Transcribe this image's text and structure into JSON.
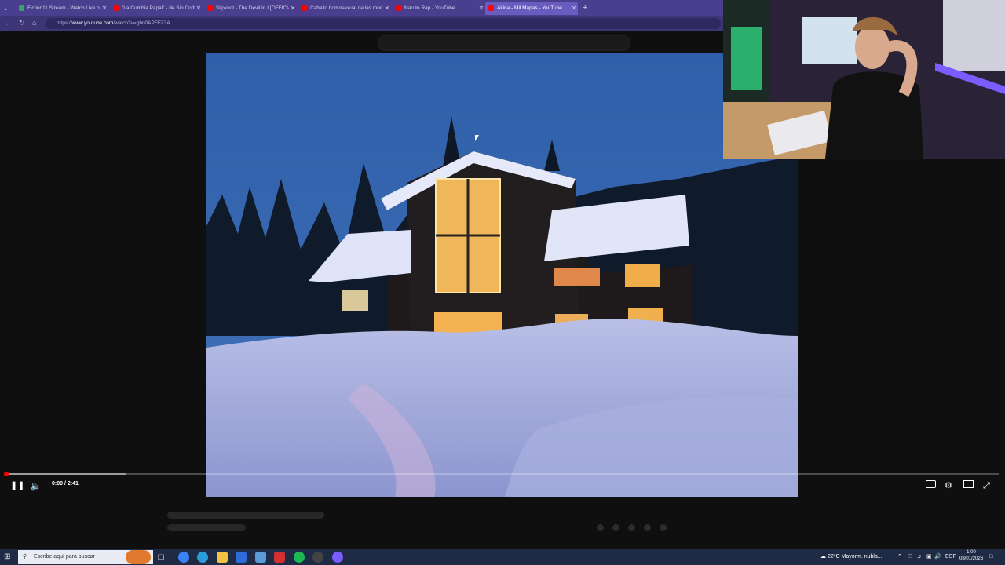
{
  "browser": {
    "tabs": [
      {
        "title": "Fiction11 Stream - Watch Live on",
        "active": false,
        "icon_color": "#3aa36b"
      },
      {
        "title": "\"La Cumbia Papal\" - de Sin Codific",
        "active": false,
        "icon_color": "#ff0000"
      },
      {
        "title": "Slipknot - The Devil In I [OFFICIAL",
        "active": false,
        "icon_color": "#ff0000"
      },
      {
        "title": "Caballo homosexual de las monta",
        "active": false,
        "icon_color": "#ff0000"
      },
      {
        "title": "Naruto Rap - YouTube",
        "active": false,
        "icon_color": "#ff0000"
      },
      {
        "title": "Akina - Mil Mapas - YouTube",
        "active": true,
        "icon_color": "#ff0000"
      }
    ],
    "url_prefix": "https://",
    "url_host": "www.youtube.com",
    "url_path": "/watch?v=gbn0APFFZ3A"
  },
  "player": {
    "time": "0:00 / 2:41",
    "progress_fraction": 0.0,
    "buffered_fraction": 0.12
  },
  "taskbar": {
    "search_placeholder": "Escribe aquí para buscar",
    "weather": "22°C  Mayorm. nubla...",
    "language": "ESP",
    "clock_time": "1:00",
    "clock_date": "08/01/2026"
  },
  "colors": {
    "accent_red": "#ff0000",
    "titlebar": "#4a3f8f",
    "taskbar": "#1f2a44"
  }
}
